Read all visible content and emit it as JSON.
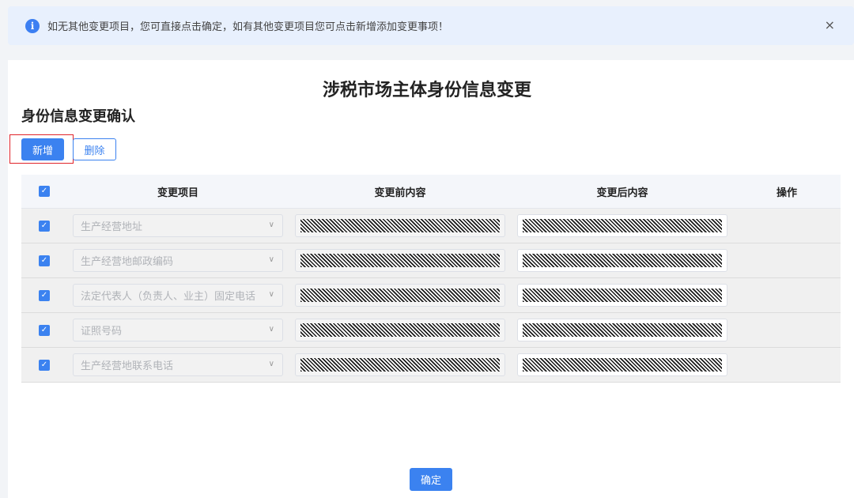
{
  "notice": {
    "icon": "info-icon",
    "text": "如无其他变更项目，您可直接点击确定，如有其他变更项目您可点击新增添加变更事项！",
    "close": "×"
  },
  "page": {
    "title": "涉税市场主体身份信息变更",
    "section_title": "身份信息变更确认"
  },
  "toolbar": {
    "add_label": "新增",
    "delete_label": "删除"
  },
  "table": {
    "header_checked": true,
    "columns": [
      "变更项目",
      "变更前内容",
      "变更后内容",
      "操作"
    ],
    "rows": [
      {
        "checked": true,
        "item": "生产经营地址",
        "before": "",
        "after": ""
      },
      {
        "checked": true,
        "item": "生产经营地邮政编码",
        "before": "",
        "after": ""
      },
      {
        "checked": true,
        "item": "法定代表人（负责人、业主）固定电话",
        "before": "",
        "after": ""
      },
      {
        "checked": true,
        "item": "证照号码",
        "before": "",
        "after": ""
      },
      {
        "checked": true,
        "item": "生产经营地联系电话",
        "before": "",
        "after": ""
      }
    ]
  },
  "footer": {
    "confirm_label": "确定"
  },
  "colors": {
    "primary": "#3b82f0",
    "notice_bg": "#e8f0fd",
    "highlight": "#e0232a"
  }
}
